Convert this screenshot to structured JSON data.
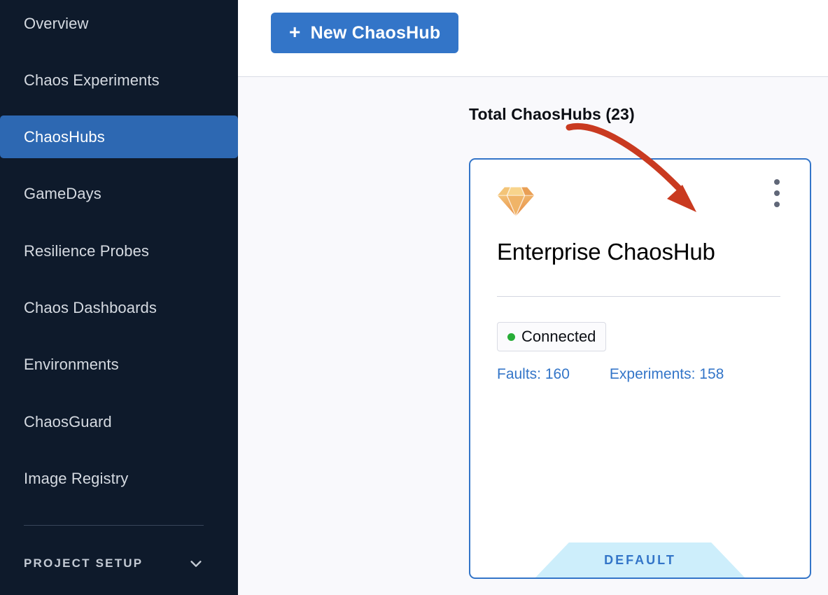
{
  "sidebar": {
    "items": [
      {
        "label": "Overview",
        "active": false
      },
      {
        "label": "Chaos Experiments",
        "active": false
      },
      {
        "label": "ChaosHubs",
        "active": true
      },
      {
        "label": "GameDays",
        "active": false
      },
      {
        "label": "Resilience Probes",
        "active": false
      },
      {
        "label": "Chaos Dashboards",
        "active": false
      },
      {
        "label": "Environments",
        "active": false
      },
      {
        "label": "ChaosGuard",
        "active": false
      },
      {
        "label": "Image Registry",
        "active": false
      }
    ],
    "project_setup": {
      "label": "PROJECT SETUP",
      "expand_icon": "chevron-down-icon"
    },
    "colors": {
      "background": "#0e1a2b",
      "active_background": "#2d68b2",
      "text": "#d5dae1",
      "divider": "#38455a"
    }
  },
  "header": {
    "new_hub_button": {
      "label": "New ChaosHub",
      "icon": "plus-icon"
    },
    "colors": {
      "button": "#3375c8",
      "background": "#ffffff",
      "border": "#d9dce5"
    }
  },
  "main": {
    "total_title": "Total ChaosHubs (23)",
    "background": "#f9f9fc",
    "card": {
      "icon": "gem-icon",
      "menu_icon": "kebab-menu-icon",
      "name": "Enterprise ChaosHub",
      "status": {
        "label": "Connected",
        "dot_color": "#27ad37"
      },
      "stats": [
        {
          "label": "Faults: 160"
        },
        {
          "label": "Experiments: 158"
        }
      ],
      "ribbon": {
        "label": "DEFAULT",
        "background": "#cdeefb",
        "text_color": "#3375c8"
      },
      "border_color": "#3375c8"
    }
  },
  "annotation": {
    "arrow": {
      "name": "red-curved-arrow",
      "color": "#c93a20"
    }
  }
}
